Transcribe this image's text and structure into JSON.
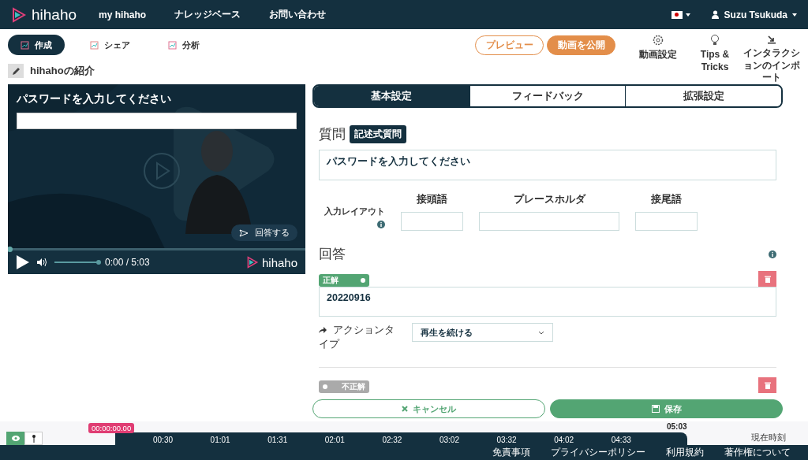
{
  "header": {
    "logo": "hihaho",
    "nav": [
      "my hihaho",
      "ナレッジベース",
      "お問い合わせ"
    ],
    "user": "Suzu Tsukuda"
  },
  "mode_tabs": [
    {
      "label": "作成",
      "selected": true
    },
    {
      "label": "シェア",
      "selected": false
    },
    {
      "label": "分析",
      "selected": false
    }
  ],
  "actions": {
    "preview": "プレビュー",
    "publish": "動画を公開"
  },
  "tools": [
    {
      "kind": "gear",
      "label": "動画設定"
    },
    {
      "kind": "bulb",
      "label": "Tips & Tricks"
    },
    {
      "kind": "import",
      "label": "インタラクションのインポート"
    }
  ],
  "video_title": "hihahoの紹介",
  "player": {
    "question": "パスワードを入力してください",
    "answer_button": "回答する",
    "progress": {
      "level": 0
    },
    "volume": {
      "level": 1
    },
    "time": "0:00 / 5:03",
    "logo": "hihaho"
  },
  "settings_tabs": [
    {
      "label": "基本設定",
      "selected": true
    },
    {
      "label": "フィードバック",
      "selected": false
    },
    {
      "label": "拡張設定",
      "selected": false
    }
  ],
  "question": {
    "heading": "質問",
    "type_badge": "記述式質問",
    "text": "パスワードを入力してください"
  },
  "input_layout": {
    "label": "入力レイアウト",
    "fields": [
      {
        "label": "接頭語"
      },
      {
        "label": "プレースホルダ"
      },
      {
        "label": "接尾語"
      }
    ]
  },
  "answers_heading": "回答",
  "answers": [
    {
      "toggle_label": "正解",
      "correct": true,
      "value": "20220916",
      "action_label": "アクションタイプ",
      "action": "再生を続ける"
    },
    {
      "toggle_label": "不正解",
      "correct": false
    }
  ],
  "buttons": {
    "cancel": "キャンセル",
    "save": "保存"
  },
  "timeline": {
    "marker": "00:00:00.00",
    "end": "05:03",
    "ticks": [
      "00:30",
      "01:01",
      "01:31",
      "02:01",
      "02:32",
      "03:02",
      "03:32",
      "04:02",
      "04:33"
    ],
    "current_label": "現在時刻"
  },
  "footer": [
    "免責事項",
    "プライバシーポリシー",
    "利用規約",
    "著作権について"
  ]
}
